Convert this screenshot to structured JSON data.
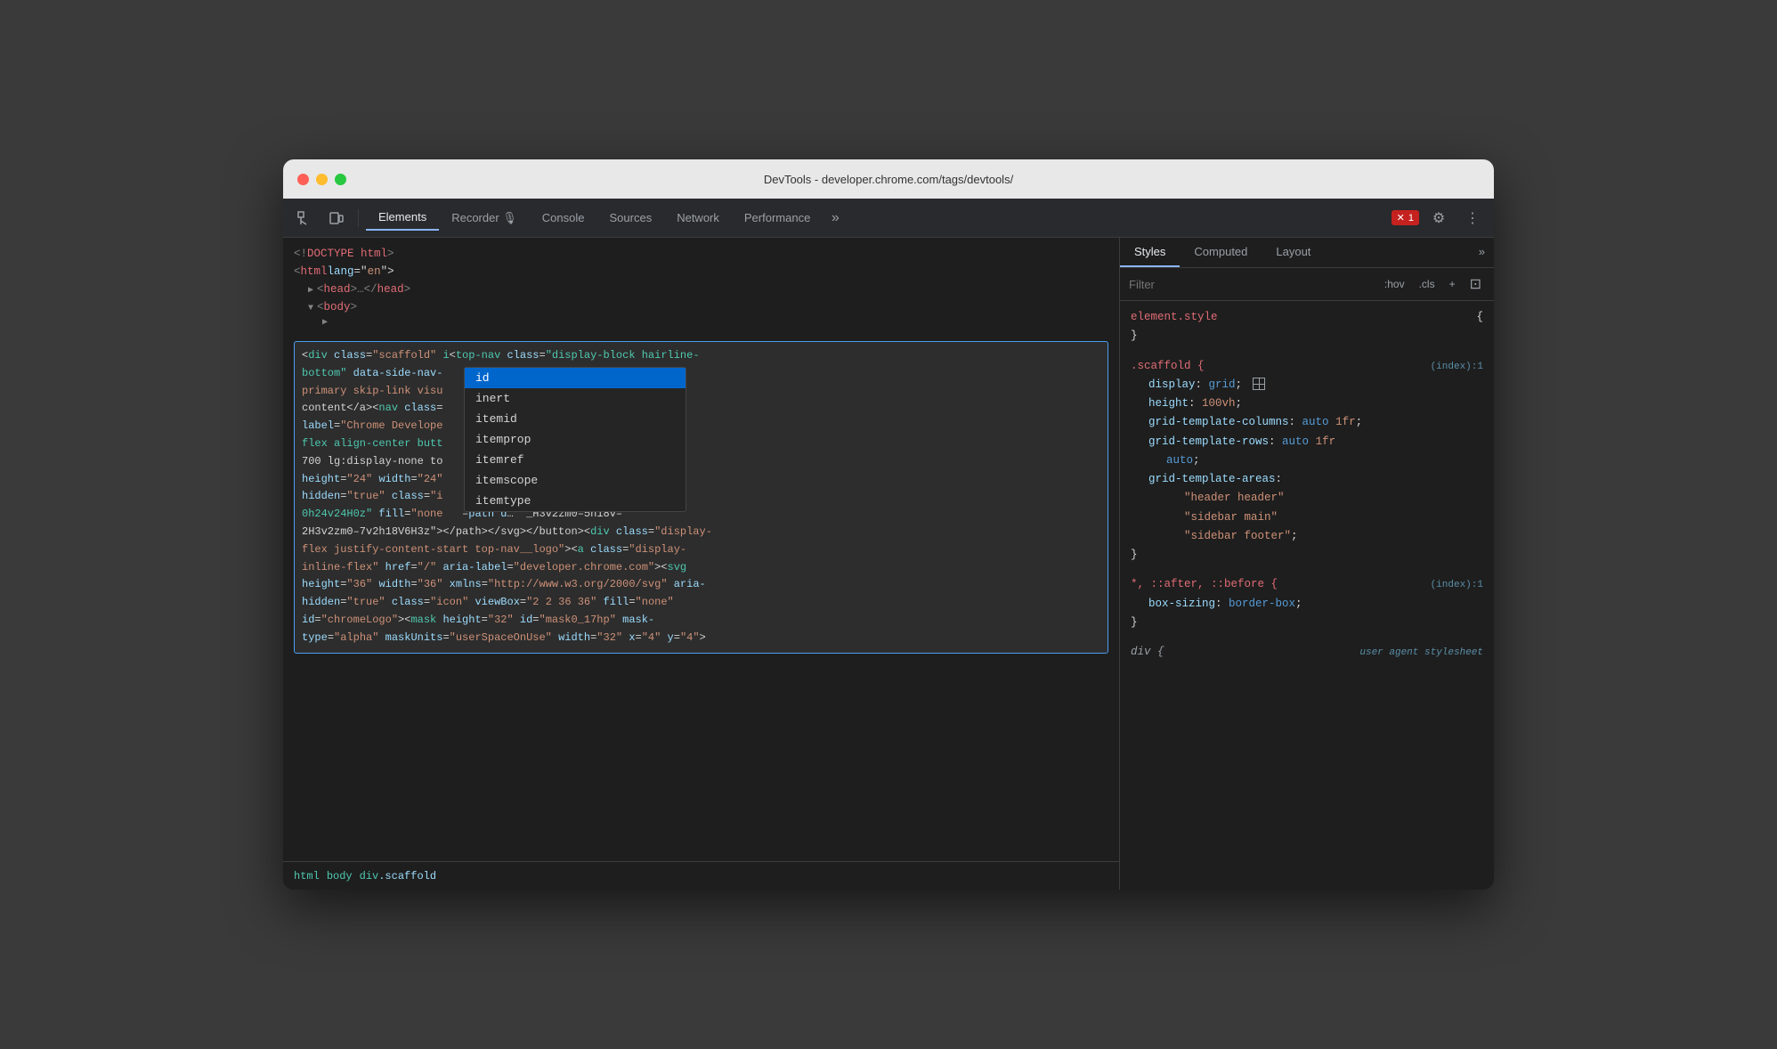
{
  "window": {
    "title": "DevTools - developer.chrome.com/tags/devtools/"
  },
  "toolbar": {
    "tabs": [
      {
        "id": "elements",
        "label": "Elements",
        "active": true
      },
      {
        "id": "recorder",
        "label": "Recorder 🎙",
        "active": false
      },
      {
        "id": "console",
        "label": "Console",
        "active": false
      },
      {
        "id": "sources",
        "label": "Sources",
        "active": false
      },
      {
        "id": "network",
        "label": "Network",
        "active": false
      },
      {
        "id": "performance",
        "label": "Performance",
        "active": false
      }
    ],
    "more_tabs_label": "»",
    "error_count": "1",
    "settings_label": "⚙",
    "more_options_label": "⋮"
  },
  "elements_panel": {
    "html_tree": [
      {
        "text": "<!DOCTYPE html>",
        "indent": 0
      },
      {
        "text": "<html lang=\"en\">",
        "indent": 0
      },
      {
        "text": "▶ <head>…</head>",
        "indent": 1
      },
      {
        "text": "▼ <body>",
        "indent": 1
      },
      {
        "text": "▶",
        "indent": 2
      }
    ],
    "selected_node_text": "<div class=\"scaffold\" i",
    "code_content": "<div class=\"scaffold\" i<top-nav class=\"display-block hairline-bottom\" data-side-nav-id ss=\"color-primary skip-link visu ent\">Skip to content</a><nav class= ria-label=\"Chrome Develope ss=\"display-flex align-center butt –center width-700 lg:display-none to height=\"24\" width=\"24\" \"menu\"><svg height=\"24\" width=\"24\" 0/svg> aria-hidden=\"true\" class=\"i h d=\"M0 0h24v24H0z\" fill=\"none –path d... <H3v2zm0-5h18v-2H3v2zm0-7v2h18V6H3z\"></path></svg></button><div class=\"display-flex justify-content-start top-nav__logo\"><a class=\"display-inline-flex\" href=\"/\" aria-label=\"developer.chrome.com\"><svg height=\"36\" width=\"36\" xmlns=\"http://www.w3.org/2000/svg\" aria-hidden=\"true\" class=\"icon\" viewBox=\"2 2 36 36\" fill=\"none\" id=\"chromeLogo\"><mask height=\"32\" id=\"mask0_17hp\" mask-type=\"alpha\" maskUnits=\"userSpaceOnUse\" width=\"32\" x=\"4\" y=\"4\">",
    "autocomplete_items": [
      {
        "id": "id",
        "label": "id",
        "selected": true
      },
      {
        "id": "inert",
        "label": "inert",
        "selected": false
      },
      {
        "id": "itemid",
        "label": "itemid",
        "selected": false
      },
      {
        "id": "itemprop",
        "label": "itemprop",
        "selected": false
      },
      {
        "id": "itemref",
        "label": "itemref",
        "selected": false
      },
      {
        "id": "itemscope",
        "label": "itemscope",
        "selected": false
      },
      {
        "id": "itemtype",
        "label": "itemtype",
        "selected": false
      }
    ],
    "breadcrumb": [
      "html",
      "body",
      "div.scaffold"
    ]
  },
  "styles_panel": {
    "tabs": [
      {
        "id": "styles",
        "label": "Styles",
        "active": true
      },
      {
        "id": "computed",
        "label": "Computed",
        "active": false
      },
      {
        "id": "layout",
        "label": "Layout",
        "active": false
      }
    ],
    "filter_placeholder": "Filter",
    "filter_btn1": ":hov",
    "filter_btn2": ".cls",
    "filter_btn3": "+",
    "css_rules": [
      {
        "selector": "element.style",
        "source": "",
        "properties": [
          {
            "prop": "",
            "val": "",
            "is_brace_open": true
          },
          {
            "prop": "",
            "val": "",
            "is_brace_close": true
          }
        ]
      },
      {
        "selector": ".scaffold",
        "source": "(index):1",
        "properties": [
          {
            "prop": "display",
            "val": "grid",
            "extra": "grid-icon"
          },
          {
            "prop": "height",
            "val": "100vh"
          },
          {
            "prop": "grid-template-columns",
            "val": "auto 1fr"
          },
          {
            "prop": "grid-template-rows",
            "val": "auto 1fr auto"
          },
          {
            "prop": "grid-template-areas",
            "val": "\"header header\" \"sidebar main\" \"sidebar footer\""
          }
        ]
      },
      {
        "selector": "*, ::after, ::before",
        "source": "(index):1",
        "properties": [
          {
            "prop": "box-sizing",
            "val": "border-box"
          }
        ]
      },
      {
        "selector": "div",
        "source": "user agent stylesheet",
        "properties": []
      }
    ]
  }
}
